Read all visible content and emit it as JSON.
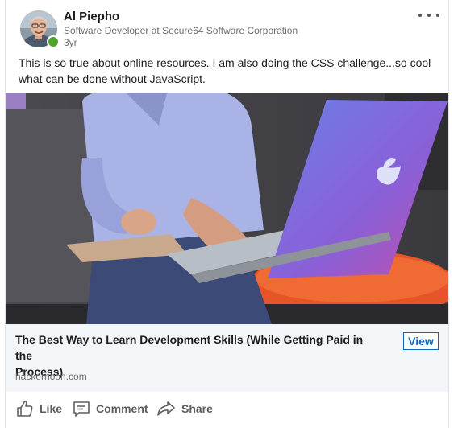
{
  "post": {
    "author": {
      "name": "Al Piepho",
      "headline": "Software Developer at Secure64 Software Corporation",
      "timestamp": "3yr",
      "presence_color": "#4ea52b"
    },
    "text": "This is so true about online resources. I am also doing the CSS challenge...so cool\nwhat can be done without JavaScript.",
    "link": {
      "title": "The Best Way to Learn Development Skills (While Getting Paid in the\nProcess)",
      "source": "hackernoon.com",
      "view_label": "View"
    },
    "actions": [
      {
        "label": "Like",
        "icon": "thumbs-up-icon"
      },
      {
        "label": "Comment",
        "icon": "comment-icon"
      },
      {
        "label": "Share",
        "icon": "share-arrow-icon"
      }
    ],
    "icons": {
      "more": "more-options-icon"
    },
    "colors": {
      "accent": "#0a66c2",
      "link_bg": "#f3f6f8",
      "muted_text": "#6f6f6f"
    }
  }
}
